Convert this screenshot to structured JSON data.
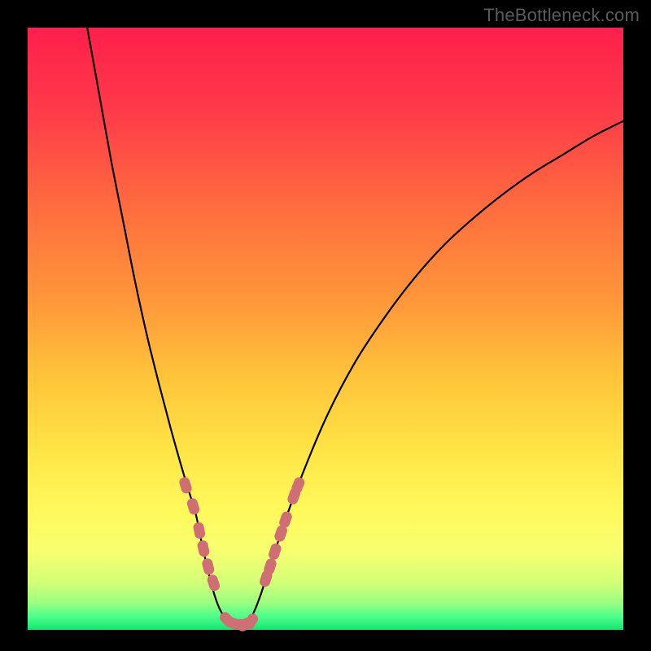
{
  "watermark": "TheBottleneck.com",
  "colors": {
    "background_black": "#000000",
    "gradient_stops": [
      {
        "offset": 0.0,
        "color": "#ff1f4b"
      },
      {
        "offset": 0.14,
        "color": "#ff3b49"
      },
      {
        "offset": 0.3,
        "color": "#ff6d3e"
      },
      {
        "offset": 0.45,
        "color": "#ff963a"
      },
      {
        "offset": 0.58,
        "color": "#ffc43a"
      },
      {
        "offset": 0.7,
        "color": "#ffe445"
      },
      {
        "offset": 0.8,
        "color": "#fff95b"
      },
      {
        "offset": 0.87,
        "color": "#f7ff6f"
      },
      {
        "offset": 0.92,
        "color": "#d3ff77"
      },
      {
        "offset": 0.955,
        "color": "#9cff80"
      },
      {
        "offset": 0.978,
        "color": "#4dff8b"
      },
      {
        "offset": 1.0,
        "color": "#14e572"
      }
    ],
    "curve_stroke": "#000000",
    "marker_fill": "#cf6f74"
  },
  "chart_data": {
    "type": "line",
    "title": "",
    "xlabel": "",
    "ylabel": "",
    "xlim": [
      0,
      100
    ],
    "ylim": [
      0,
      100
    ],
    "grid": false,
    "legend": false,
    "series": [
      {
        "name": "bottleneck-curve",
        "x": [
          10.0,
          12.0,
          14.0,
          16.0,
          18.0,
          20.0,
          22.0,
          24.0,
          26.0,
          28.0,
          28.5,
          29.0,
          30.0,
          31.0,
          32.0,
          33.0,
          34.0,
          35.0,
          36.0,
          37.0,
          38.0,
          39.0,
          40.0,
          42.0,
          45.0,
          50.0,
          55.0,
          60.0,
          65.0,
          70.0,
          75.0,
          80.0,
          85.0,
          90.0,
          95.0,
          100.0
        ],
        "y": [
          100.0,
          89.0,
          78.0,
          68.0,
          58.0,
          49.0,
          41.0,
          33.5,
          26.5,
          20.0,
          18.0,
          15.5,
          11.0,
          7.0,
          4.0,
          2.2,
          1.2,
          0.8,
          0.8,
          1.4,
          3.0,
          5.5,
          8.5,
          14.5,
          23.0,
          35.0,
          44.5,
          52.0,
          58.5,
          64.0,
          68.5,
          72.5,
          76.0,
          79.0,
          82.0,
          84.5
        ]
      }
    ],
    "markers": {
      "name": "highlighted-points",
      "shape": "rounded-rect",
      "x": [
        26.5,
        27.8,
        28.8,
        29.5,
        30.3,
        31.2,
        33.5,
        34.5,
        35.5,
        36.5,
        37.5,
        40.0,
        40.7,
        41.5,
        42.5,
        43.3,
        44.7,
        45.4
      ],
      "y": [
        24.0,
        20.5,
        16.5,
        13.5,
        10.5,
        7.8,
        1.7,
        1.1,
        0.9,
        0.9,
        1.4,
        8.5,
        10.5,
        13.0,
        16.0,
        18.3,
        22.2,
        24.0
      ]
    }
  }
}
